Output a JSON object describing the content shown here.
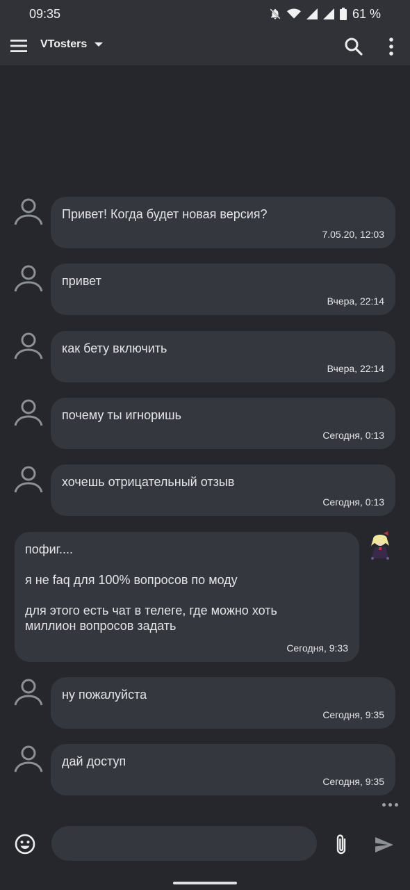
{
  "status_bar": {
    "time": "09:35",
    "battery": "61 %"
  },
  "app_bar": {
    "title": "VTosters",
    "icons": [
      "menu-icon",
      "dropdown-arrow-icon",
      "search-icon",
      "more-vert-icon"
    ]
  },
  "messages": [
    {
      "sender": "other",
      "text": "Привет! Когда будет новая версия?",
      "time": "7.05.20, 12:03"
    },
    {
      "sender": "other",
      "text": "привет",
      "time": "Вчера, 22:14"
    },
    {
      "sender": "other",
      "text": "как бету включить",
      "time": "Вчера, 22:14"
    },
    {
      "sender": "other",
      "text": "почему ты игноришь",
      "time": "Сегодня, 0:13"
    },
    {
      "sender": "other",
      "text": "хочешь отрицательный отзыв",
      "time": "Сегодня, 0:13"
    },
    {
      "sender": "me",
      "text": "пофиг....\n\nя не faq для 100% вопросов по моду\n\nдля этого есть чат в телеге, где можно хоть\nмиллион вопросов задать",
      "time": "Сегодня, 9:33"
    },
    {
      "sender": "other",
      "text": "ну пожалуйста",
      "time": "Сегодня, 9:35"
    },
    {
      "sender": "other",
      "text": "дай доступ",
      "time": "Сегодня, 9:35"
    }
  ],
  "input": {
    "value": "",
    "placeholder": ""
  },
  "colors": {
    "background": "#25272c",
    "bar": "#303237",
    "bubble": "#34373d",
    "text": "#e4e5e8"
  }
}
